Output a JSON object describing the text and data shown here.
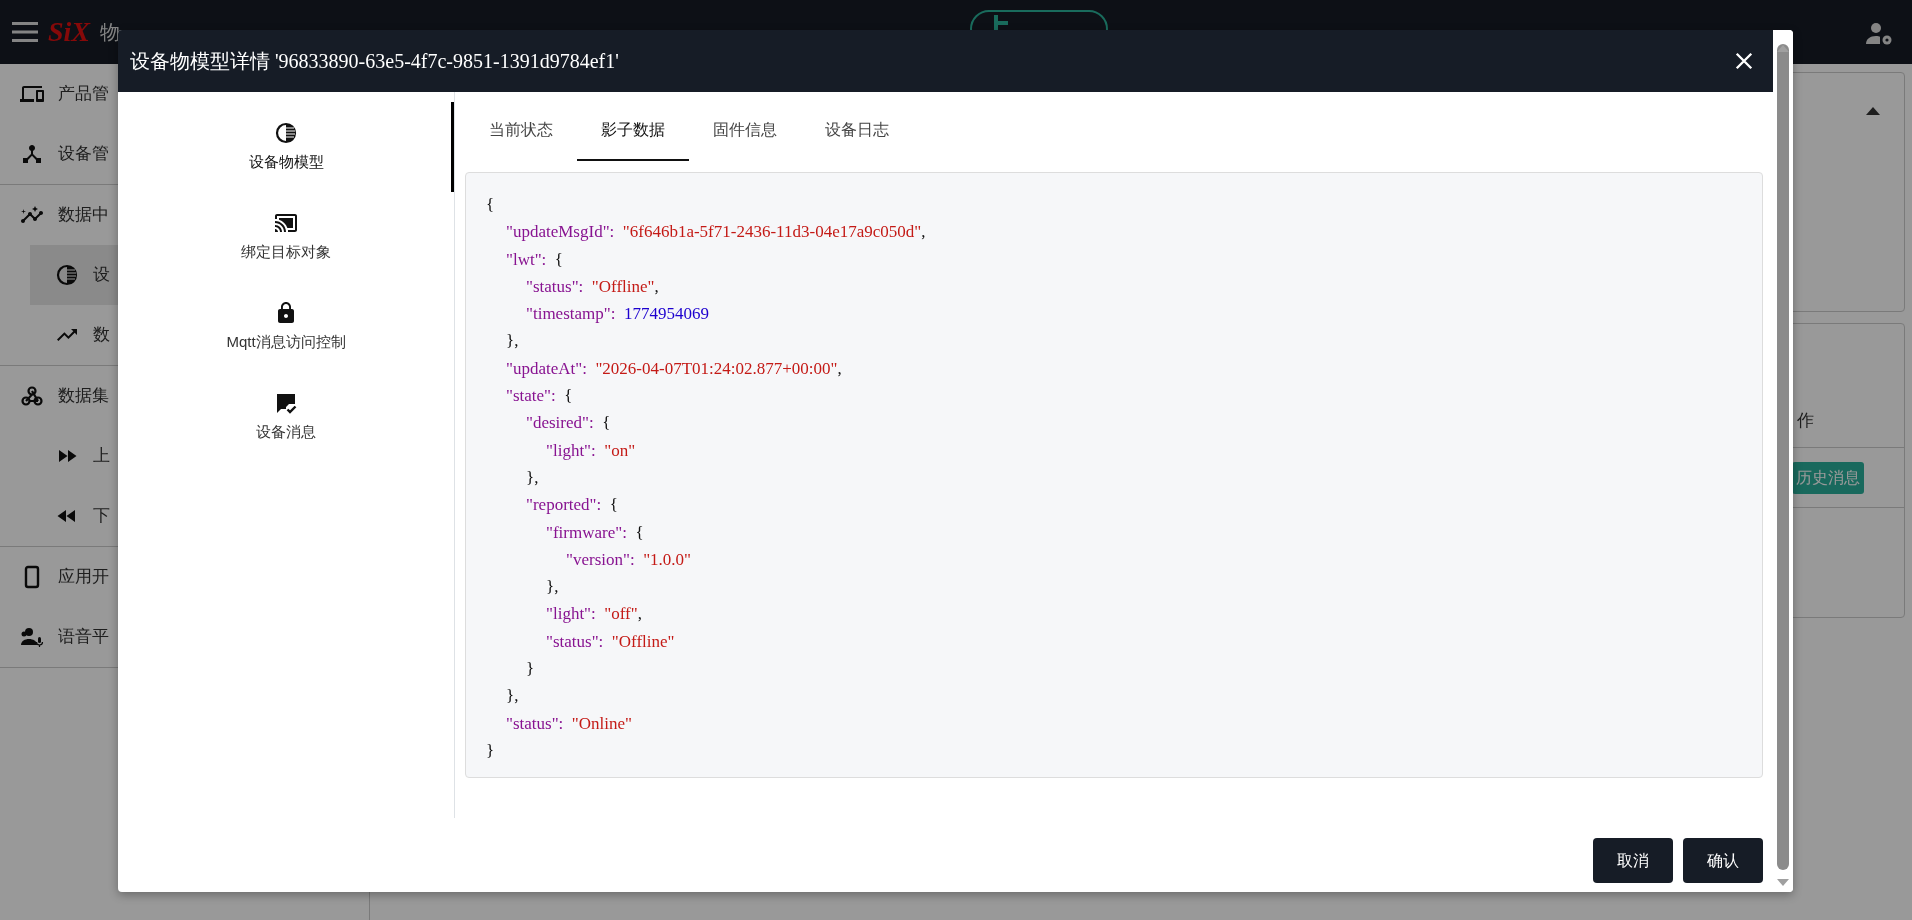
{
  "header": {
    "logo": "SiX",
    "title": "物"
  },
  "sidebar": {
    "groups": [
      {
        "items": [
          {
            "label": "产品管",
            "selected": false
          },
          {
            "label": "设备管",
            "selected": false
          }
        ]
      },
      {
        "items": [
          {
            "label": "数据中",
            "selected": false,
            "children": [
              {
                "label": "设",
                "selected": true
              },
              {
                "label": "数",
                "selected": false
              }
            ]
          }
        ]
      },
      {
        "items": [
          {
            "label": "数据集",
            "selected": false,
            "children": [
              {
                "label": "上",
                "selected": false
              },
              {
                "label": "下",
                "selected": false
              }
            ]
          }
        ]
      },
      {
        "items": [
          {
            "label": "应用开",
            "selected": false
          },
          {
            "label": "语音平",
            "selected": false
          }
        ]
      }
    ]
  },
  "background_card": {
    "column_heading": "作",
    "button": "历史消息"
  },
  "dialog": {
    "title": "设备物模型详情 '96833890-63e5-4f7c-9851-1391d9784ef1'",
    "nav": [
      {
        "label": "设备物模型",
        "selected": true
      },
      {
        "label": "绑定目标对象",
        "selected": false
      },
      {
        "label": "Mqtt消息访问控制",
        "selected": false
      },
      {
        "label": "设备消息",
        "selected": false
      }
    ],
    "tabs": [
      {
        "label": "当前状态",
        "selected": false
      },
      {
        "label": "影子数据",
        "selected": true
      },
      {
        "label": "固件信息",
        "selected": false
      },
      {
        "label": "设备日志",
        "selected": false
      }
    ],
    "shadow_json": {
      "open": "{",
      "close": "}",
      "children": [
        {
          "key": "\"updateMsgId\":",
          "value": "\"6f646b1a-5f71-2436-11d3-04e17a9c050d\"",
          "kind": "string",
          "punct": ","
        },
        {
          "key": "\"lwt\":",
          "open": "{",
          "kind": "object",
          "close": "},",
          "children": [
            {
              "key": "\"status\":",
              "value": "\"Offline\"",
              "kind": "string",
              "punct": ","
            },
            {
              "key": "\"timestamp\":",
              "value": "1774954069",
              "kind": "number"
            }
          ]
        },
        {
          "key": "\"updateAt\":",
          "value": "\"2026-04-07T01:24:02.877+00:00\"",
          "kind": "string",
          "punct": ","
        },
        {
          "key": "\"state\":",
          "open": "{",
          "kind": "object",
          "close": "},",
          "children": [
            {
              "key": "\"desired\":",
              "open": "{",
              "kind": "object",
              "close": "},",
              "children": [
                {
                  "key": "\"light\":",
                  "value": "\"on\"",
                  "kind": "string"
                }
              ]
            },
            {
              "key": "\"reported\":",
              "open": "{",
              "kind": "object",
              "close": "}",
              "children": [
                {
                  "key": "\"firmware\":",
                  "open": "{",
                  "kind": "object",
                  "close": "},",
                  "children": [
                    {
                      "key": "\"version\":",
                      "value": "\"1.0.0\"",
                      "kind": "string"
                    }
                  ]
                },
                {
                  "key": "\"light\":",
                  "value": "\"off\"",
                  "kind": "string",
                  "punct": ","
                },
                {
                  "key": "\"status\":",
                  "value": "\"Offline\"",
                  "kind": "string"
                }
              ]
            }
          ]
        },
        {
          "key": "\"status\":",
          "value": "\"Online\"",
          "kind": "string"
        }
      ]
    },
    "buttons": [
      {
        "label": "取消"
      },
      {
        "label": "确认"
      }
    ]
  }
}
